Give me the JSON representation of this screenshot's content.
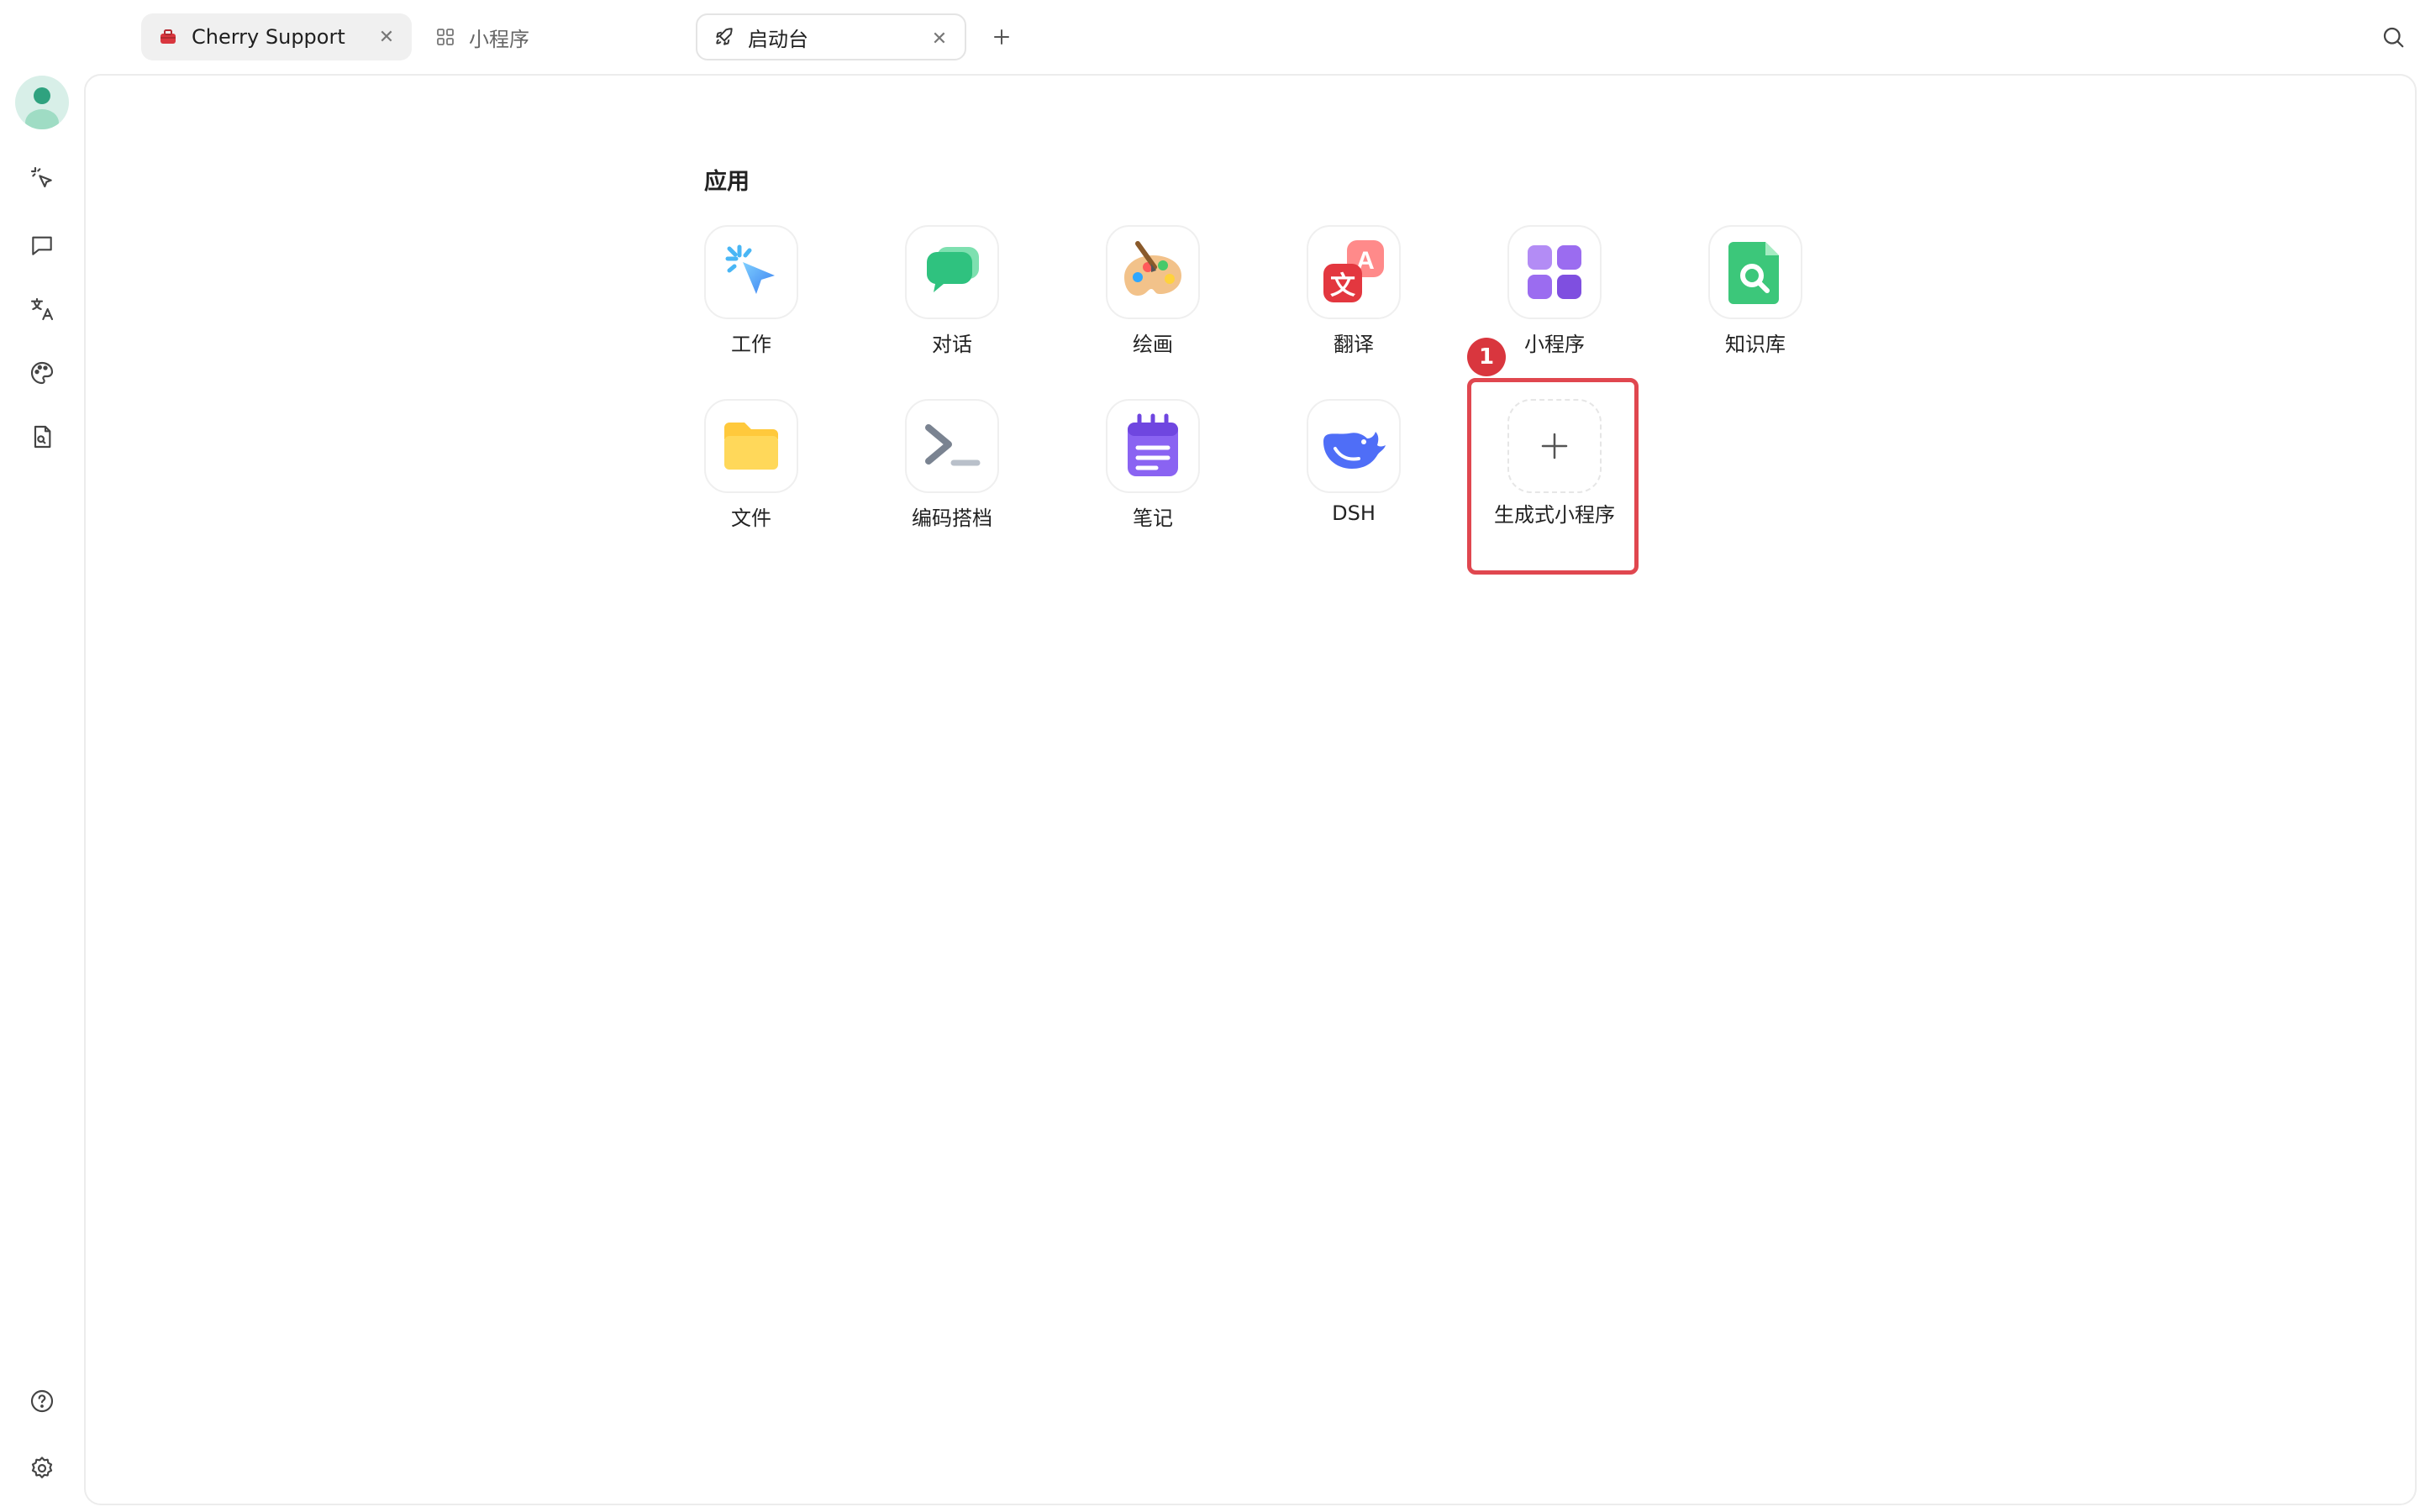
{
  "tabs": [
    {
      "label": "Cherry Support",
      "icon": "toolbox-icon",
      "active": false,
      "closable": true
    },
    {
      "label": "小程序",
      "icon": "grid-icon",
      "active": false,
      "closable": false
    },
    {
      "label": "启动台",
      "icon": "rocket-icon",
      "active": true,
      "closable": true
    }
  ],
  "topbar": {
    "new_tab_icon": "plus-icon",
    "search_icon": "search-icon"
  },
  "sidebar": {
    "items": [
      {
        "icon": "sparkle-cursor-icon",
        "label": "工作"
      },
      {
        "icon": "chat-bubble-icon",
        "label": "对话"
      },
      {
        "icon": "translate-icon",
        "label": "翻译"
      },
      {
        "icon": "palette-icon",
        "label": "绘画"
      },
      {
        "icon": "file-search-icon",
        "label": "知识库"
      }
    ],
    "bottom": [
      {
        "icon": "help-icon"
      },
      {
        "icon": "settings-icon"
      }
    ]
  },
  "launchpad": {
    "section_title": "应用",
    "apps": [
      {
        "label": "工作",
        "icon": "agent-cursor-icon"
      },
      {
        "label": "对话",
        "icon": "chat-icon"
      },
      {
        "label": "绘画",
        "icon": "paint-palette-icon"
      },
      {
        "label": "翻译",
        "icon": "translate-app-icon"
      },
      {
        "label": "小程序",
        "icon": "mini-apps-icon"
      },
      {
        "label": "知识库",
        "icon": "knowledge-base-icon"
      },
      {
        "label": "文件",
        "icon": "folder-icon"
      },
      {
        "label": "编码搭档",
        "icon": "terminal-icon"
      },
      {
        "label": "笔记",
        "icon": "notepad-icon"
      },
      {
        "label": "DSH",
        "icon": "whale-icon"
      }
    ],
    "create_app": {
      "label": "生成式小程序",
      "icon": "plus-icon"
    }
  },
  "annotation": {
    "badge": "1",
    "color": "#d9363e"
  }
}
